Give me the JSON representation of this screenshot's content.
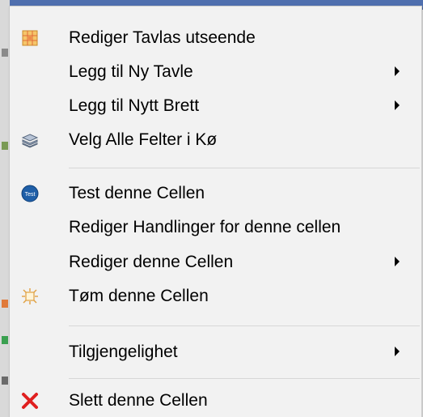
{
  "menu": {
    "items": [
      {
        "label": "Rediger Tavlas utseende",
        "icon": "grid-palette-icon"
      },
      {
        "label": "Legg til Ny Tavle",
        "icon": null,
        "submenu": true
      },
      {
        "label": "Legg til Nytt Brett",
        "icon": null,
        "submenu": true
      },
      {
        "label": "Velg Alle Felter i Kø",
        "icon": "stacked-layers-icon"
      },
      {
        "label": "Test denne Cellen",
        "icon": "test-badge-icon",
        "icon_text": "Test"
      },
      {
        "label": "Rediger Handlinger for denne cellen",
        "icon": null
      },
      {
        "label": "Rediger denne Cellen",
        "icon": null,
        "submenu": true
      },
      {
        "label": "Tøm denne Cellen",
        "icon": "clear-burst-icon"
      },
      {
        "label": "Tilgjengelighet",
        "icon": null,
        "submenu": true
      },
      {
        "label": "Slett denne Cellen",
        "icon": "delete-x-icon"
      }
    ]
  },
  "colors": {
    "menu_background": "#f2f2f2",
    "separator": "#d7d7d7",
    "delete_red": "#e02020",
    "test_blue": "#1f5fa8",
    "window_accent": "#4f6fae"
  }
}
